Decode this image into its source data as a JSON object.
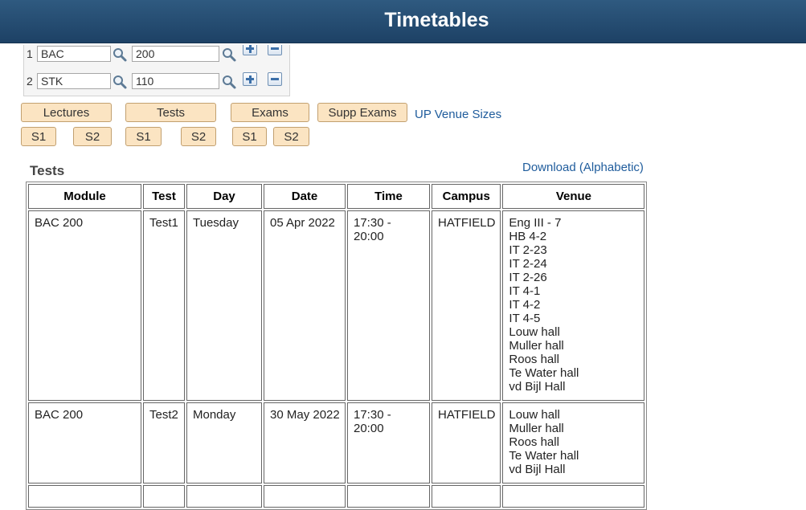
{
  "header": {
    "title": "Timetables"
  },
  "search": {
    "rows": [
      {
        "num": "1",
        "module": "BAC",
        "code": "200"
      },
      {
        "num": "2",
        "module": "STK",
        "code": "110"
      }
    ]
  },
  "buttons": {
    "lectures": "Lectures",
    "tests": "Tests",
    "exams": "Exams",
    "supp_exams": "Supp Exams",
    "s1": "S1",
    "s2": "S2"
  },
  "links": {
    "venue_sizes": "UP Venue Sizes",
    "download": "Download (Alphabetic)"
  },
  "section": {
    "title": "Tests"
  },
  "table": {
    "headers": [
      "Module",
      "Test",
      "Day",
      "Date",
      "Time",
      "Campus",
      "Venue"
    ],
    "rows": [
      {
        "module": "BAC 200",
        "test": "Test1",
        "day": "Tuesday",
        "date": "05 Apr 2022",
        "time": "17:30 - 20:00",
        "campus": "HATFIELD",
        "venues": [
          "Eng III - 7",
          "HB 4-2",
          "IT 2-23",
          "IT 2-24",
          "IT 2-26",
          "IT 4-1",
          "IT 4-2",
          "IT 4-5",
          "Louw hall",
          "Muller hall",
          "Roos hall",
          "Te Water hall",
          "vd Bijl Hall"
        ]
      },
      {
        "module": "BAC 200",
        "test": "Test2",
        "day": "Monday",
        "date": "30 May 2022",
        "time": "17:30 - 20:00",
        "campus": "HATFIELD",
        "venues": [
          "Louw hall",
          "Muller hall",
          "Roos hall",
          "Te Water hall",
          "vd Bijl Hall"
        ]
      }
    ]
  },
  "colors": {
    "header_bg": "#1d4165",
    "button_bg": "#fbe4c2",
    "link": "#1f5c9c"
  }
}
